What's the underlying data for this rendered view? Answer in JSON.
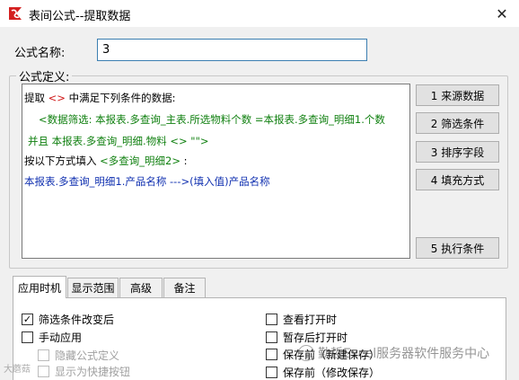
{
  "window": {
    "title": "表间公式--提取数据",
    "close_glyph": "✕",
    "app_icon": "red-swirl-logo-icon"
  },
  "formula_name": {
    "label": "公式名称:",
    "value": "3"
  },
  "definition": {
    "legend": "公式定义:",
    "lines": {
      "l1_a": "提取",
      "l1_b": "<>",
      "l1_c": "中满足下列条件的数据:",
      "l2": "<数据筛选: 本报表.多查询_主表.所选物料个数 =本报表.多查询_明细1.个数",
      "l3": "并且 本报表.多查询_明细.物料 <> \"\">",
      "l4_a": "按以下方式填入",
      "l4_b": "<多查询_明细2>",
      "l4_c": ":",
      "l5": "本报表.多查询_明细1.产品名称  --->(填入值)产品名称"
    }
  },
  "side_buttons": {
    "source": "1  来源数据",
    "filter": "2  筛选条件",
    "sort": "3  排序字段",
    "fill": "4  填充方式",
    "exec": "5  执行条件"
  },
  "tabs": [
    "应用时机",
    "显示范围",
    "高级",
    "备注"
  ],
  "options": {
    "filter_change": {
      "label": "筛选条件改变后",
      "checked": true
    },
    "manual": {
      "label": "手动应用",
      "checked": false
    },
    "hide_formula": {
      "label": "隐藏公式定义",
      "checked": false
    },
    "show_shortcut": {
      "label": "显示为快捷按钮",
      "checked": false
    },
    "view_open": {
      "label": "查看打开时",
      "checked": false
    },
    "save_draft_open": {
      "label": "暂存后打开时",
      "checked": false
    },
    "save_before_new": {
      "label": "保存前（新建保存）",
      "checked": false
    },
    "save_before_modify": {
      "label": "保存前（修改保存）",
      "checked": false
    }
  },
  "colors": {
    "keyword_red": "#d01818",
    "condition_green": "#108010",
    "fill_blue": "#1030b0",
    "input_border": "#3c7fb1"
  },
  "watermark": {
    "text": "勤哲Excel服务器软件服务中心",
    "small": "大蘑菇"
  }
}
